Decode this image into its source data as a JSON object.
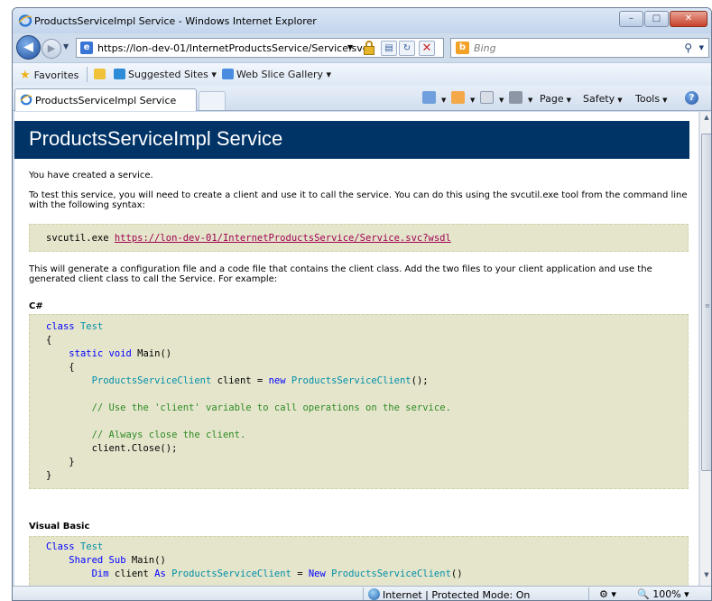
{
  "window": {
    "title": "ProductsServiceImpl Service - Windows Internet Explorer",
    "minimize": "–",
    "maximize": "□",
    "close": "✕"
  },
  "address_bar": {
    "url": "https://lon-dev-01/InternetProductsService/Service.svc",
    "back_glyph": "◀",
    "forward_glyph": "▶"
  },
  "search": {
    "placeholder": "Bing",
    "engine_icon": "bing-icon"
  },
  "favorites_bar": {
    "favorites_label": "Favorites",
    "suggested_sites": "Suggested Sites ▾",
    "web_slice_gallery": "Web Slice Gallery ▾"
  },
  "tabs": [
    {
      "label": "ProductsServiceImpl Service",
      "active": true
    }
  ],
  "command_bar": {
    "page": "Page",
    "safety": "Safety",
    "tools": "Tools",
    "help": "?"
  },
  "content": {
    "heading": "ProductsServiceImpl Service",
    "created_text": "You have created a service.",
    "test_text": "To test this service, you will need to create a client and use it to call the service. You can do this using the svcutil.exe tool from the command line with the following syntax:",
    "svcutil_cmd": "svcutil.exe ",
    "wsdl_link": "https://lon-dev-01/InternetProductsService/Service.svc?wsdl",
    "generate_text": "This will generate a configuration file and a code file that contains the client class. Add the two files to your client application and use the generated client class to call the Service. For example:",
    "csharp_label": "C#",
    "vb_label": "Visual Basic",
    "csharp_code": {
      "l1_kw": "class",
      "l1_ty": "Test",
      "l2": "{",
      "l3_kw": "static void",
      "l3_rest": " Main()",
      "l4": "{",
      "l5_ty": "ProductsServiceClient",
      "l5_mid": " client = ",
      "l5_kw": "new",
      "l5_ty2": "ProductsServiceClient",
      "l5_end": "();",
      "l6_cm": "// Use the 'client' variable to call operations on the service.",
      "l7_cm": "// Always close the client.",
      "l8": "client.Close();",
      "l9": "}",
      "l10": "}"
    },
    "vb_code": {
      "l1_kw": "Class",
      "l1_ty": "Test",
      "l2_kw": "Shared Sub",
      "l2_rest": " Main()",
      "l3_kw": "Dim",
      "l3_mid": " client ",
      "l3_kw2": "As",
      "l3_ty": "ProductsServiceClient",
      "l3_eq": " = ",
      "l3_kw3": "New",
      "l3_ty2": "ProductsServiceClient",
      "l3_end": "()"
    }
  },
  "status_bar": {
    "zone": "Internet | Protected Mode: On",
    "zoom": "100%"
  }
}
